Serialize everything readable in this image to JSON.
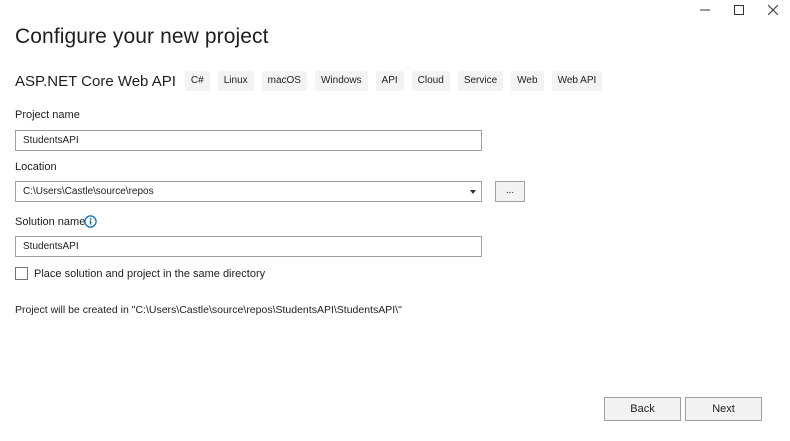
{
  "window": {
    "controls": [
      "minimize-icon",
      "maximize-icon",
      "close-icon"
    ]
  },
  "page_title": "Configure your new project",
  "template": {
    "name": "ASP.NET Core Web API",
    "tags": [
      "C#",
      "Linux",
      "macOS",
      "Windows",
      "API",
      "Cloud",
      "Service",
      "Web",
      "Web API"
    ]
  },
  "project_name": {
    "label": "Project name",
    "value": "StudentsAPI"
  },
  "location": {
    "label": "Location",
    "value": "C:\\Users\\Castle\\source\\repos",
    "browse_label": "..."
  },
  "solution_name": {
    "label": "Solution name",
    "value": "StudentsAPI"
  },
  "same_directory": {
    "label": "Place solution and project in the same directory",
    "checked": false
  },
  "created_note": "Project will be created in \"C:\\Users\\Castle\\source\\repos\\StudentsAPI\\StudentsAPI\\\"",
  "buttons": {
    "back": "Back",
    "next": "Next"
  },
  "colors": {
    "accent": "#0067c0",
    "border": "#a0a0a0",
    "tag_bg": "#f3f3f3"
  }
}
